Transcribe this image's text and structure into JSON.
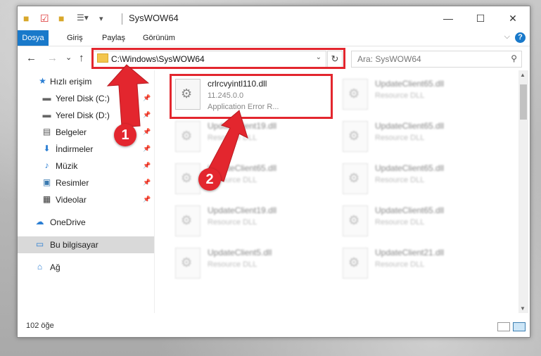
{
  "window": {
    "title": "SysWOW64",
    "minimize": "—",
    "maximize": "☐",
    "close": "✕"
  },
  "ribbon": {
    "tabs": [
      "Dosya",
      "Giriş",
      "Paylaş",
      "Görünüm"
    ],
    "help": "?",
    "expand": "⌵"
  },
  "nav": {
    "back": "←",
    "forward": "→",
    "recent": "⌄",
    "up": "↑",
    "address": "C:\\Windows\\SysWOW64",
    "address_dropdown": "⌄",
    "refresh": "↻",
    "search_placeholder": "Ara: SysWOW64",
    "search_icon": "⚲"
  },
  "sidebar": {
    "items": [
      {
        "label": "Hızlı erişim",
        "icon": "star-icon",
        "glyph": "★",
        "pinned": false
      },
      {
        "label": "Yerel Disk (C:)",
        "icon": "drive-icon",
        "glyph": "▬",
        "pinned": true
      },
      {
        "label": "Yerel Disk (D:)",
        "icon": "drive-icon",
        "glyph": "▬",
        "pinned": true
      },
      {
        "label": "Belgeler",
        "icon": "document-icon",
        "glyph": "▤",
        "pinned": true
      },
      {
        "label": "İndirmeler",
        "icon": "download-icon",
        "glyph": "⬇",
        "pinned": true
      },
      {
        "label": "Müzik",
        "icon": "music-icon",
        "glyph": "♪",
        "pinned": true
      },
      {
        "label": "Resimler",
        "icon": "pictures-icon",
        "glyph": "▣",
        "pinned": true
      },
      {
        "label": "Videolar",
        "icon": "video-icon",
        "glyph": "▦",
        "pinned": true
      },
      {
        "label": "OneDrive",
        "icon": "cloud-icon",
        "glyph": "☁",
        "pinned": false
      },
      {
        "label": "Bu bilgisayar",
        "icon": "computer-icon",
        "glyph": "▭",
        "pinned": false
      },
      {
        "label": "Ağ",
        "icon": "network-icon",
        "glyph": "⌂",
        "pinned": false
      }
    ],
    "pin_glyph": "📌"
  },
  "files": [
    {
      "name": "crlrcvyintl110.dll",
      "line2": "11.245.0.0",
      "line3": "Application Error R...",
      "highlight": true
    },
    {
      "name": "UpdateClient65.dll",
      "line2": "Resource DLL",
      "line3": ""
    },
    {
      "name": "UpdateClient19.dll",
      "line2": "Resource DLL",
      "line3": ""
    },
    {
      "name": "UpdateClient65.dll",
      "line2": "Resource DLL",
      "line3": ""
    },
    {
      "name": "UpdateClient65.dll",
      "line2": "Resource DLL",
      "line3": ""
    },
    {
      "name": "UpdateClient65.dll",
      "line2": "Resource DLL",
      "line3": ""
    },
    {
      "name": "UpdateClient19.dll",
      "line2": "Resource DLL",
      "line3": ""
    },
    {
      "name": "UpdateClient65.dll",
      "line2": "Resource DLL",
      "line3": ""
    },
    {
      "name": "UpdateClient5.dll",
      "line2": "Resource DLL",
      "line3": ""
    },
    {
      "name": "UpdateClient21.dll",
      "line2": "Resource DLL",
      "line3": ""
    }
  ],
  "status": {
    "count": "102 öğe"
  },
  "callouts": [
    "1",
    "2"
  ],
  "colors": {
    "accent": "#1979ca",
    "highlight_red": "#e3262e"
  }
}
